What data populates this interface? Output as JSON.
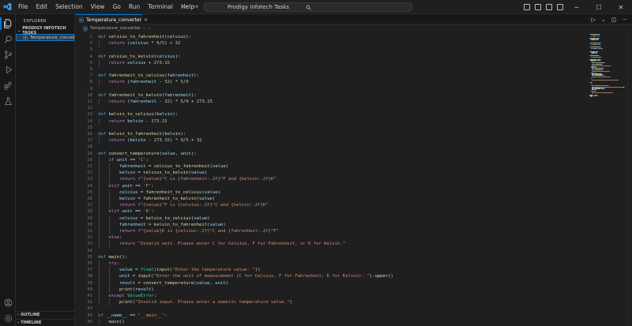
{
  "menu": [
    "File",
    "Edit",
    "Selection",
    "View",
    "Go",
    "Run",
    "Terminal",
    "Help"
  ],
  "search": {
    "label": "Prodigy Infotech Tasks"
  },
  "sidebar": {
    "title": "EXPLORER",
    "folder": "PRODIGY INFOTECH TASKS",
    "file": "Temperature_converter",
    "outline": "OUTLINE",
    "timeline": "TIMELINE"
  },
  "tab": {
    "label": "Temperature_converter",
    "close": "×"
  },
  "breadcrumb": {
    "file": "Temperature_converter",
    "rest": "..."
  },
  "colors": {
    "accent": "#0078d4",
    "background": "#1f1f1f",
    "keyword": "#569cd6",
    "function": "#dcdcaa",
    "string": "#ce9178"
  },
  "code": [
    {
      "n": "1",
      "t": [
        [
          "kw",
          "def "
        ],
        [
          "fn",
          "celsius_to_fahrenheit"
        ],
        [
          "op",
          "("
        ],
        [
          "var",
          "celsius"
        ],
        [
          "op",
          "):"
        ]
      ]
    },
    {
      "n": "2",
      "t": [
        [
          "op",
          "    "
        ],
        [
          "ctl",
          "return "
        ],
        [
          "op",
          "("
        ],
        [
          "var",
          "celsius"
        ],
        [
          "op",
          " * "
        ],
        [
          "num",
          "9"
        ],
        [
          "op",
          "/"
        ],
        [
          "num",
          "5"
        ],
        [
          "op",
          ") + "
        ],
        [
          "num",
          "32"
        ]
      ]
    },
    {
      "n": "3",
      "t": []
    },
    {
      "n": "4",
      "t": [
        [
          "kw",
          "def "
        ],
        [
          "fn",
          "celsius_to_kelvin"
        ],
        [
          "op",
          "("
        ],
        [
          "var",
          "celsius"
        ],
        [
          "op",
          "):"
        ]
      ]
    },
    {
      "n": "5",
      "t": [
        [
          "op",
          "    "
        ],
        [
          "ctl",
          "return "
        ],
        [
          "var",
          "celsius"
        ],
        [
          "op",
          " + "
        ],
        [
          "num",
          "273.15"
        ]
      ]
    },
    {
      "n": "6",
      "t": []
    },
    {
      "n": "7",
      "t": [
        [
          "kw",
          "def "
        ],
        [
          "fn",
          "fahrenheit_to_celsius"
        ],
        [
          "op",
          "("
        ],
        [
          "var",
          "fahrenheit"
        ],
        [
          "op",
          "):"
        ]
      ]
    },
    {
      "n": "8",
      "t": [
        [
          "op",
          "    "
        ],
        [
          "ctl",
          "return "
        ],
        [
          "op",
          "("
        ],
        [
          "var",
          "fahrenheit"
        ],
        [
          "op",
          " - "
        ],
        [
          "num",
          "32"
        ],
        [
          "op",
          ") * "
        ],
        [
          "num",
          "5"
        ],
        [
          "op",
          "/"
        ],
        [
          "num",
          "9"
        ]
      ]
    },
    {
      "n": "9",
      "t": []
    },
    {
      "n": "10",
      "t": [
        [
          "kw",
          "def "
        ],
        [
          "fn",
          "fahrenheit_to_kelvin"
        ],
        [
          "op",
          "("
        ],
        [
          "var",
          "fahrenheit"
        ],
        [
          "op",
          "):"
        ]
      ]
    },
    {
      "n": "11",
      "t": [
        [
          "op",
          "    "
        ],
        [
          "ctl",
          "return "
        ],
        [
          "op",
          "("
        ],
        [
          "var",
          "fahrenheit"
        ],
        [
          "op",
          " - "
        ],
        [
          "num",
          "32"
        ],
        [
          "op",
          ") * "
        ],
        [
          "num",
          "5"
        ],
        [
          "op",
          "/"
        ],
        [
          "num",
          "9"
        ],
        [
          "op",
          " + "
        ],
        [
          "num",
          "273.15"
        ]
      ]
    },
    {
      "n": "12",
      "t": []
    },
    {
      "n": "13",
      "t": [
        [
          "kw",
          "def "
        ],
        [
          "fn",
          "kelvin_to_celsius"
        ],
        [
          "op",
          "("
        ],
        [
          "var",
          "kelvin"
        ],
        [
          "op",
          "):"
        ]
      ]
    },
    {
      "n": "14",
      "t": [
        [
          "op",
          "    "
        ],
        [
          "ctl",
          "return "
        ],
        [
          "var",
          "kelvin"
        ],
        [
          "op",
          " - "
        ],
        [
          "num",
          "273.15"
        ]
      ]
    },
    {
      "n": "15",
      "t": []
    },
    {
      "n": "16",
      "t": [
        [
          "kw",
          "def "
        ],
        [
          "fn",
          "kelvin_to_fahrenheit"
        ],
        [
          "op",
          "("
        ],
        [
          "var",
          "kelvin"
        ],
        [
          "op",
          "):"
        ]
      ]
    },
    {
      "n": "17",
      "t": [
        [
          "op",
          "    "
        ],
        [
          "ctl",
          "return "
        ],
        [
          "op",
          "("
        ],
        [
          "var",
          "kelvin"
        ],
        [
          "op",
          " - "
        ],
        [
          "num",
          "273.15"
        ],
        [
          "op",
          ") * "
        ],
        [
          "num",
          "9"
        ],
        [
          "op",
          "/"
        ],
        [
          "num",
          "5"
        ],
        [
          "op",
          " + "
        ],
        [
          "num",
          "32"
        ]
      ]
    },
    {
      "n": "18",
      "t": []
    },
    {
      "n": "19",
      "t": [
        [
          "kw",
          "def "
        ],
        [
          "fn",
          "convert_temperature"
        ],
        [
          "op",
          "("
        ],
        [
          "var",
          "value"
        ],
        [
          "op",
          ", "
        ],
        [
          "var",
          "unit"
        ],
        [
          "op",
          "):"
        ]
      ]
    },
    {
      "n": "20",
      "t": [
        [
          "op",
          "    "
        ],
        [
          "ctl",
          "if "
        ],
        [
          "var",
          "unit"
        ],
        [
          "op",
          " == "
        ],
        [
          "str",
          "'C'"
        ],
        [
          "op",
          ":"
        ]
      ]
    },
    {
      "n": "21",
      "t": [
        [
          "op",
          "        "
        ],
        [
          "var",
          "fahrenheit"
        ],
        [
          "op",
          " = "
        ],
        [
          "fn",
          "celsius_to_fahrenheit"
        ],
        [
          "op",
          "("
        ],
        [
          "var",
          "value"
        ],
        [
          "op",
          ")"
        ]
      ]
    },
    {
      "n": "22",
      "t": [
        [
          "op",
          "        "
        ],
        [
          "var",
          "kelvin"
        ],
        [
          "op",
          " = "
        ],
        [
          "fn",
          "celsius_to_kelvin"
        ],
        [
          "op",
          "("
        ],
        [
          "var",
          "value"
        ],
        [
          "op",
          ")"
        ]
      ]
    },
    {
      "n": "23",
      "t": [
        [
          "op",
          "        "
        ],
        [
          "ctl",
          "return "
        ],
        [
          "kw",
          "f"
        ],
        [
          "str",
          "\"{value}°C is {fahrenheit:.2f}°F and {kelvin:.2f}K\""
        ]
      ]
    },
    {
      "n": "24",
      "t": [
        [
          "op",
          "    "
        ],
        [
          "ctl",
          "elif "
        ],
        [
          "var",
          "unit"
        ],
        [
          "op",
          " == "
        ],
        [
          "str",
          "'F'"
        ],
        [
          "op",
          ":"
        ]
      ]
    },
    {
      "n": "25",
      "t": [
        [
          "op",
          "        "
        ],
        [
          "var",
          "celsius"
        ],
        [
          "op",
          " = "
        ],
        [
          "fn",
          "fahrenheit_to_celsius"
        ],
        [
          "op",
          "("
        ],
        [
          "var",
          "value"
        ],
        [
          "op",
          ")"
        ]
      ]
    },
    {
      "n": "26",
      "t": [
        [
          "op",
          "        "
        ],
        [
          "var",
          "kelvin"
        ],
        [
          "op",
          " = "
        ],
        [
          "fn",
          "fahrenheit_to_kelvin"
        ],
        [
          "op",
          "("
        ],
        [
          "var",
          "value"
        ],
        [
          "op",
          ")"
        ]
      ]
    },
    {
      "n": "27",
      "t": [
        [
          "op",
          "        "
        ],
        [
          "ctl",
          "return "
        ],
        [
          "kw",
          "f"
        ],
        [
          "str",
          "\"{value}°F is {celsius:.2f}°C and {kelvin:.2f}K\""
        ]
      ]
    },
    {
      "n": "28",
      "t": [
        [
          "op",
          "    "
        ],
        [
          "ctl",
          "elif "
        ],
        [
          "var",
          "unit"
        ],
        [
          "op",
          " == "
        ],
        [
          "str",
          "'K'"
        ],
        [
          "op",
          ":"
        ]
      ]
    },
    {
      "n": "29",
      "t": [
        [
          "op",
          "        "
        ],
        [
          "var",
          "celsius"
        ],
        [
          "op",
          " = "
        ],
        [
          "fn",
          "kelvin_to_celsius"
        ],
        [
          "op",
          "("
        ],
        [
          "var",
          "value"
        ],
        [
          "op",
          ")"
        ]
      ]
    },
    {
      "n": "30",
      "t": [
        [
          "op",
          "        "
        ],
        [
          "var",
          "fahrenheit"
        ],
        [
          "op",
          " = "
        ],
        [
          "fn",
          "kelvin_to_fahrenheit"
        ],
        [
          "op",
          "("
        ],
        [
          "var",
          "value"
        ],
        [
          "op",
          ")"
        ]
      ]
    },
    {
      "n": "31",
      "t": [
        [
          "op",
          "        "
        ],
        [
          "ctl",
          "return "
        ],
        [
          "kw",
          "f"
        ],
        [
          "str",
          "\"{value}K is {celsius:.2f}°C and {fahrenheit:.2f}°F\""
        ]
      ]
    },
    {
      "n": "32",
      "t": [
        [
          "op",
          "    "
        ],
        [
          "ctl",
          "else"
        ],
        [
          "op",
          ":"
        ]
      ]
    },
    {
      "n": "33",
      "t": [
        [
          "op",
          "        "
        ],
        [
          "ctl",
          "return "
        ],
        [
          "str",
          "\"Invalid unit. Please enter C for Celsius, F for Fahrenheit, or K for Kelvin.\""
        ]
      ]
    },
    {
      "n": "34",
      "t": []
    },
    {
      "n": "35",
      "t": [
        [
          "kw",
          "def "
        ],
        [
          "fn",
          "main"
        ],
        [
          "op",
          "():"
        ]
      ]
    },
    {
      "n": "36",
      "t": [
        [
          "op",
          "    "
        ],
        [
          "ctl",
          "try"
        ],
        [
          "op",
          ":"
        ]
      ]
    },
    {
      "n": "37",
      "t": [
        [
          "op",
          "        "
        ],
        [
          "var",
          "value"
        ],
        [
          "op",
          " = "
        ],
        [
          "cls",
          "float"
        ],
        [
          "op",
          "("
        ],
        [
          "fn",
          "input"
        ],
        [
          "op",
          "("
        ],
        [
          "str",
          "\"Enter the temperature value: \""
        ],
        [
          "op",
          "))"
        ]
      ]
    },
    {
      "n": "38",
      "t": [
        [
          "op",
          "        "
        ],
        [
          "var",
          "unit"
        ],
        [
          "op",
          " = "
        ],
        [
          "fn",
          "input"
        ],
        [
          "op",
          "("
        ],
        [
          "str",
          "\"Enter the unit of measurement (C for Celsius, F for Fahrenheit, K for Kelvin): \""
        ],
        [
          "op",
          ")."
        ],
        [
          "fn",
          "upper"
        ],
        [
          "op",
          "()"
        ]
      ]
    },
    {
      "n": "39",
      "t": [
        [
          "op",
          "        "
        ],
        [
          "var",
          "result"
        ],
        [
          "op",
          " = "
        ],
        [
          "fn",
          "convert_temperature"
        ],
        [
          "op",
          "("
        ],
        [
          "var",
          "value"
        ],
        [
          "op",
          ", "
        ],
        [
          "var",
          "unit"
        ],
        [
          "op",
          ")"
        ]
      ]
    },
    {
      "n": "40",
      "t": [
        [
          "op",
          "        "
        ],
        [
          "fn",
          "print"
        ],
        [
          "op",
          "("
        ],
        [
          "var",
          "result"
        ],
        [
          "op",
          ")"
        ]
      ]
    },
    {
      "n": "41",
      "t": [
        [
          "op",
          "    "
        ],
        [
          "ctl",
          "except "
        ],
        [
          "cls",
          "ValueError"
        ],
        [
          "op",
          ":"
        ]
      ]
    },
    {
      "n": "42",
      "t": [
        [
          "op",
          "        "
        ],
        [
          "fn",
          "print"
        ],
        [
          "op",
          "("
        ],
        [
          "str",
          "\"Invalid input. Please enter a numeric temperature value.\""
        ],
        [
          "op",
          ")"
        ]
      ]
    },
    {
      "n": "43",
      "t": []
    },
    {
      "n": "44",
      "t": [
        [
          "ctl",
          "if "
        ],
        [
          "var",
          "__name__"
        ],
        [
          "op",
          " == "
        ],
        [
          "str",
          "\"__main__\""
        ],
        [
          "op",
          ":"
        ]
      ]
    },
    {
      "n": "45",
      "t": [
        [
          "op",
          "    "
        ],
        [
          "fn",
          "main"
        ],
        [
          "op",
          "()"
        ]
      ]
    }
  ]
}
